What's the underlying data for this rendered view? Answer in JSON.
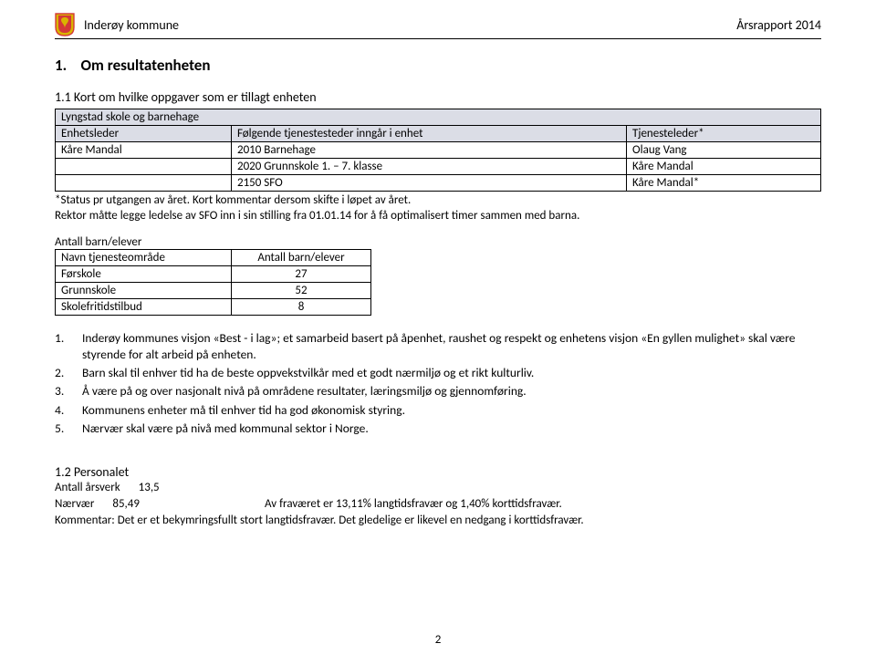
{
  "header": {
    "municipality": "Inderøy kommune",
    "report": "Årsrapport 2014"
  },
  "section1": {
    "heading_num": "1.",
    "heading_text": "Om resultatenheten"
  },
  "sub1_1": {
    "heading": "1.1 Kort om hvilke oppgaver som er tillagt enheten",
    "row_full": "Lyngstad skole og barnehage",
    "col1": "Enhetsleder",
    "col2": "Følgende tjenestesteder inngår i enhet",
    "col3": "Tjenesteleder*",
    "r1c1": "Kåre Mandal",
    "r1c2": "2010 Barnehage",
    "r1c3": "Olaug Vang",
    "r2c2": "2020 Grunnskole 1. – 7. klasse",
    "r2c3": "Kåre Mandal",
    "r3c2": "2150 SFO",
    "r3c3": "Kåre Mandal*",
    "after1": "*Status pr utgangen av året. Kort kommentar dersom skifte i løpet av året.",
    "after2": "Rektor måtte legge ledelse av SFO inn i sin stilling fra 01.01.14 for å få optimalisert timer sammen med barna."
  },
  "children": {
    "label": "Antall barn/elever",
    "h1": "Navn tjenesteområde",
    "h2": "Antall barn/elever",
    "r1a": "Førskole",
    "r1b": "27",
    "r2a": "Grunnskole",
    "r2b": "52",
    "r3a": "Skolefritidstilbud",
    "r3b": "8"
  },
  "list": {
    "i1n": "1.",
    "i1t": "Inderøy kommunes visjon «Best - i lag»; et samarbeid basert på åpenhet, raushet og respekt og enhetens visjon «En gyllen mulighet» skal være styrende for alt arbeid på enheten.",
    "i2n": "2.",
    "i2t": "Barn skal til enhver tid ha de beste oppvekstvilkår med et godt nærmiljø og et rikt kulturliv.",
    "i3n": "3.",
    "i3t": "Å være på og over nasjonalt nivå på områdene resultater, læringsmiljø og gjennomføring.",
    "i4n": "4.",
    "i4t": "Kommunens enheter må til enhver tid ha god økonomisk styring.",
    "i5n": "5.",
    "i5t": "Nærvær skal være på nivå med kommunal sektor i Norge."
  },
  "sub1_2": {
    "heading": "1.2 Personalet",
    "years_lbl": "Antall årsverk",
    "years_val": "13,5",
    "near_lbl": "Nærvær",
    "near_val": "85,49",
    "absence": "Av fraværet er 13,11% langtidsfravær og 1,40% korttidsfravær.",
    "comment": "Kommentar: Det er et bekymringsfullt stort langtidsfravær. Det gledelige er likevel en nedgang i korttidsfravær."
  },
  "page_number": "2"
}
